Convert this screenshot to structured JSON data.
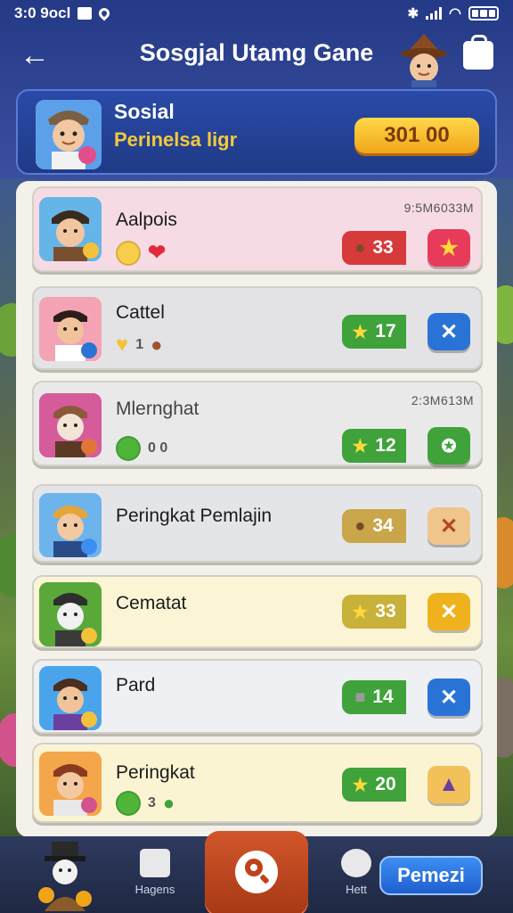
{
  "status_bar": {
    "time": "3:0 9ocl"
  },
  "header": {
    "title": "Sosgjal Utamg Gane"
  },
  "profile": {
    "name": "Sosial",
    "subtitle": "Perinelsa ligr",
    "score": "301 00"
  },
  "rows": [
    {
      "name": "Aalpois",
      "time": "9:5M6033M",
      "pill_value": "33",
      "pill_icon": "coin-icon",
      "action_icon": "star-icon",
      "mini_text": "",
      "colors": {
        "bg": "#f7dbe4",
        "pill": "#d63a3a",
        "action": "#e83a5a"
      }
    },
    {
      "name": "Cattel",
      "time": "",
      "pill_value": "17",
      "pill_icon": "star-icon",
      "action_icon": "swap-icon",
      "mini_text": "1",
      "colors": {
        "bg": "#e3e3e6",
        "pill": "#3fa23a",
        "action": "#2a73d6"
      }
    },
    {
      "name": "Mlernghat",
      "time": "2:3M613M",
      "pill_value": "12",
      "pill_icon": "star-icon",
      "action_icon": "badge-icon",
      "mini_text": "0 0",
      "colors": {
        "bg": "#e9e9ea",
        "pill": "#3fa23a",
        "action": "#3fa23a"
      }
    },
    {
      "name": "Peringkat Pemlajin",
      "time": "",
      "pill_value": "34",
      "pill_icon": "coin-icon",
      "action_icon": "tool-icon",
      "mini_text": "",
      "colors": {
        "bg": "#e4e5e8",
        "pill": "#c9a64a",
        "action": "#f0c58c"
      }
    },
    {
      "name": "Cematat",
      "time": "",
      "pill_value": "33",
      "pill_icon": "star-icon",
      "action_icon": "swap-icon",
      "mini_text": "",
      "colors": {
        "bg": "#fbf5d6",
        "pill": "#c8b13a",
        "action": "#f0b21c"
      }
    },
    {
      "name": "Pard",
      "time": "",
      "pill_value": "14",
      "pill_icon": "gem-icon",
      "action_icon": "close-icon",
      "mini_text": "",
      "colors": {
        "bg": "#eef0f3",
        "pill": "#3fa23a",
        "action": "#2a73d6"
      }
    },
    {
      "name": "Peringkat",
      "time": "",
      "pill_value": "20",
      "pill_icon": "star-icon",
      "action_icon": "wizard-icon",
      "mini_text": "3",
      "colors": {
        "bg": "#fbf4d3",
        "pill": "#3fa23a",
        "action": "#f3c15a"
      }
    }
  ],
  "bottom_nav": {
    "item2_label": "Hagens",
    "item4_label": "Hett",
    "cta_label": "Pemezi"
  }
}
